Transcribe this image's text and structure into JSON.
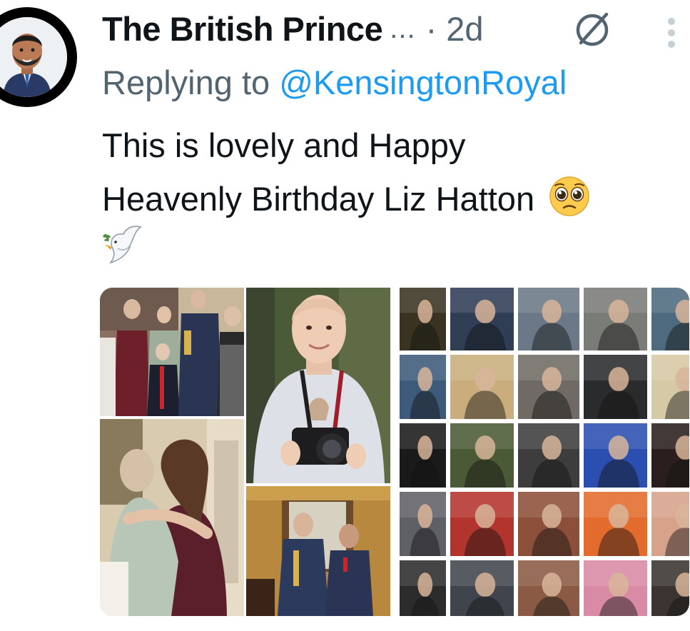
{
  "tweet": {
    "author_name": "The British Prince",
    "name_truncation": "...",
    "timestamp": "· 2d",
    "reply_prefix": "Replying to",
    "reply_handle": "@KensingtonRoyal",
    "text_line1": "This is lovely and Happy",
    "text_line2": "Heavenly Birthday Liz Hatton"
  },
  "icons": {
    "avatar": "bitmoji-avatar",
    "grok": "grok-icon",
    "more": "more-vertical-icon",
    "emoji_1": "pleading-face-emoji",
    "emoji_2": "dove-emoji"
  },
  "colors": {
    "text": "#0f1419",
    "secondary": "#536471",
    "link": "#1d9bf0"
  },
  "media": {
    "left_collage": [
      "family-group-photo",
      "portrait-with-camera",
      "hug-photo",
      "investiture-photo"
    ],
    "right_grid_count": 25
  }
}
